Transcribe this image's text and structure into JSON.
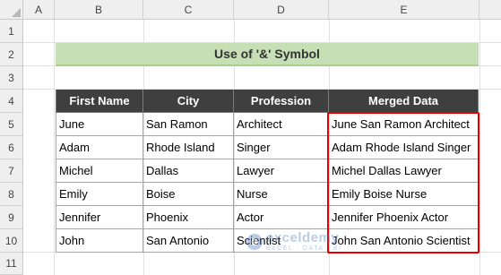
{
  "columns": [
    "A",
    "B",
    "C",
    "D",
    "E"
  ],
  "rows": [
    "1",
    "2",
    "3",
    "4",
    "5",
    "6",
    "7",
    "8",
    "9",
    "10",
    "11"
  ],
  "title": "Use of '&' Symbol",
  "table": {
    "headers": [
      "First Name",
      "City",
      "Profession",
      "Merged Data"
    ],
    "rows": [
      [
        "June",
        "San Ramon",
        "Architect",
        "June San Ramon Architect"
      ],
      [
        "Adam",
        "Rhode Island",
        "Singer",
        "Adam Rhode Island Singer"
      ],
      [
        "Michel",
        "Dallas",
        "Lawyer",
        "Michel Dallas Lawyer"
      ],
      [
        "Emily",
        "Boise",
        "Nurse",
        "Emily Boise Nurse"
      ],
      [
        "Jennifer",
        "Phoenix",
        "Actor",
        "Jennifer Phoenix Actor"
      ],
      [
        "John",
        "San Antonio",
        "Scientist",
        "John San Antonio Scientist"
      ]
    ]
  },
  "watermark": {
    "main": "exceldemy",
    "sub": "EXCEL · DATA · BI"
  },
  "colors": {
    "header_fill": "#3f3f3f",
    "title_fill": "#c6dfb4",
    "highlight": "#e60000"
  }
}
